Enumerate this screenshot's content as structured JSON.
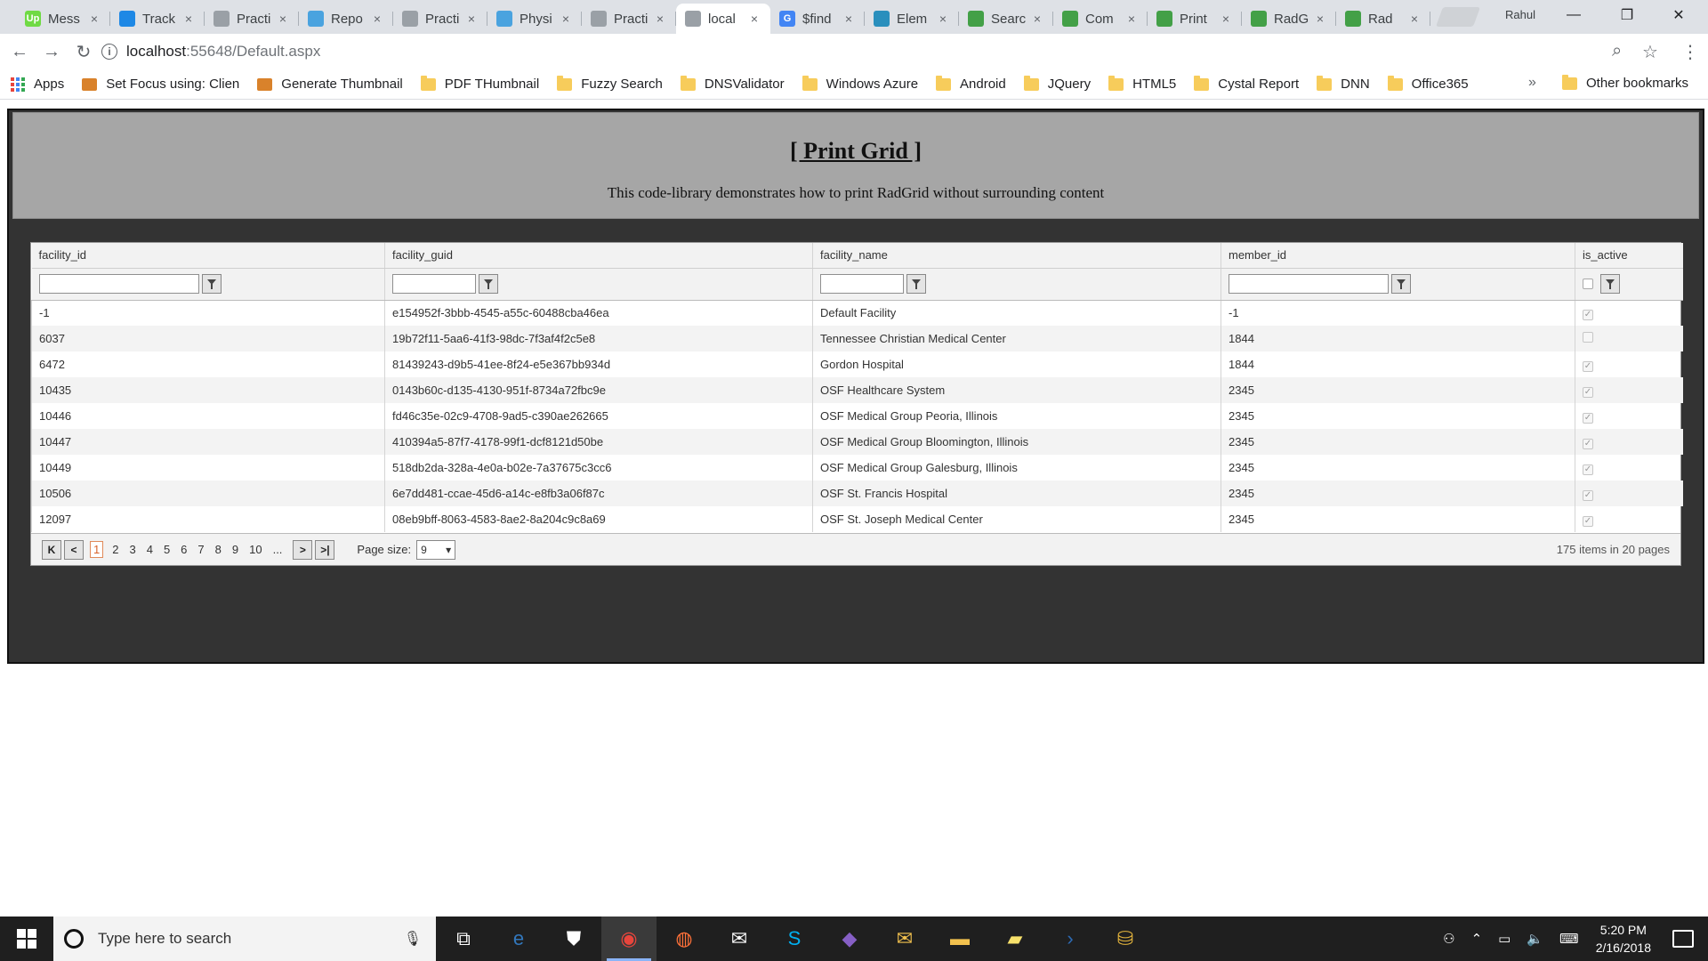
{
  "browser": {
    "tabs": [
      {
        "title": "Mess",
        "fav_text": "Up",
        "fav_color": "#6fda44"
      },
      {
        "title": "Track",
        "fav_text": "",
        "fav_color": "#1e88e5"
      },
      {
        "title": "Practi",
        "fav_text": "",
        "fav_color": "#9aa0a6"
      },
      {
        "title": "Repo",
        "fav_text": "",
        "fav_color": "#4aa3df"
      },
      {
        "title": "Practi",
        "fav_text": "",
        "fav_color": "#9aa0a6"
      },
      {
        "title": "Physi",
        "fav_text": "",
        "fav_color": "#4aa3df"
      },
      {
        "title": "Practi",
        "fav_text": "",
        "fav_color": "#9aa0a6"
      },
      {
        "title": "local",
        "fav_text": "",
        "fav_color": "#9aa0a6",
        "active": true
      },
      {
        "title": "$find",
        "fav_text": "G",
        "fav_color": "#4285f4"
      },
      {
        "title": "Elem",
        "fav_text": "",
        "fav_color": "#2a8fbd"
      },
      {
        "title": "Searc",
        "fav_text": "",
        "fav_color": "#43a047"
      },
      {
        "title": "Com",
        "fav_text": "",
        "fav_color": "#43a047"
      },
      {
        "title": "Print",
        "fav_text": "",
        "fav_color": "#43a047"
      },
      {
        "title": "RadG",
        "fav_text": "",
        "fav_color": "#43a047"
      },
      {
        "title": "Rad",
        "fav_text": "",
        "fav_color": "#43a047"
      }
    ],
    "close_glyph": "×",
    "profile_name": "Rahul",
    "window_controls": {
      "minimize": "—",
      "maximize": "❐",
      "close": "✕"
    },
    "url_host": "localhost",
    "url_path": ":55648/Default.aspx",
    "nav": {
      "back": "←",
      "forward": "→",
      "reload": "↻",
      "zoom": "⌕",
      "star": "☆",
      "menu": "⋮"
    },
    "bookmarks": [
      {
        "label": "Apps",
        "icon": "apps-grid-icon"
      },
      {
        "label": "Set Focus using: Clien",
        "icon": "page-icon"
      },
      {
        "label": "Generate Thumbnail",
        "icon": "page-icon"
      },
      {
        "label": "PDF THumbnail",
        "icon": "folder-icon"
      },
      {
        "label": "Fuzzy Search",
        "icon": "folder-icon"
      },
      {
        "label": "DNSValidator",
        "icon": "folder-icon"
      },
      {
        "label": "Windows Azure",
        "icon": "folder-icon"
      },
      {
        "label": "Android",
        "icon": "folder-icon"
      },
      {
        "label": "JQuery",
        "icon": "folder-icon"
      },
      {
        "label": "HTML5",
        "icon": "folder-icon"
      },
      {
        "label": "Cystal Report",
        "icon": "folder-icon"
      },
      {
        "label": "DNN",
        "icon": "folder-icon"
      },
      {
        "label": "Office365",
        "icon": "folder-icon"
      }
    ],
    "bookmarks_overflow": "»",
    "other_bookmarks": "Other bookmarks"
  },
  "page": {
    "print_link": "[ Print Grid ]",
    "subtitle": "This code-library demonstrates how to print RadGrid without surrounding content"
  },
  "grid": {
    "columns": [
      "facility_id",
      "facility_guid",
      "facility_name",
      "member_id",
      "is_active"
    ],
    "rows": [
      {
        "facility_id": "-1",
        "facility_guid": "e154952f-3bbb-4545-a55c-60488cba46ea",
        "facility_name": "Default Facility",
        "member_id": "-1",
        "is_active": true
      },
      {
        "facility_id": "6037",
        "facility_guid": "19b72f11-5aa6-41f3-98dc-7f3af4f2c5e8",
        "facility_name": "Tennessee Christian Medical Center",
        "member_id": "1844",
        "is_active": false
      },
      {
        "facility_id": "6472",
        "facility_guid": "81439243-d9b5-41ee-8f24-e5e367bb934d",
        "facility_name": "Gordon Hospital",
        "member_id": "1844",
        "is_active": true
      },
      {
        "facility_id": "10435",
        "facility_guid": "0143b60c-d135-4130-951f-8734a72fbc9e",
        "facility_name": "OSF Healthcare System",
        "member_id": "2345",
        "is_active": true
      },
      {
        "facility_id": "10446",
        "facility_guid": "fd46c35e-02c9-4708-9ad5-c390ae262665",
        "facility_name": "OSF Medical Group Peoria, Illinois",
        "member_id": "2345",
        "is_active": true
      },
      {
        "facility_id": "10447",
        "facility_guid": "410394a5-87f7-4178-99f1-dcf8121d50be",
        "facility_name": "OSF Medical Group Bloomington, Illinois",
        "member_id": "2345",
        "is_active": true
      },
      {
        "facility_id": "10449",
        "facility_guid": "518db2da-328a-4e0a-b02e-7a37675c3cc6",
        "facility_name": "OSF Medical Group Galesburg, Illinois",
        "member_id": "2345",
        "is_active": true
      },
      {
        "facility_id": "10506",
        "facility_guid": "6e7dd481-ccae-45d6-a14c-e8fb3a06f87c",
        "facility_name": "OSF St. Francis Hospital",
        "member_id": "2345",
        "is_active": true
      },
      {
        "facility_id": "12097",
        "facility_guid": "08eb9bff-8063-4583-8ae2-8a204c9c8a69",
        "facility_name": "OSF St. Joseph Medical Center",
        "member_id": "2345",
        "is_active": true
      }
    ],
    "pager": {
      "first": "K",
      "prev": "<",
      "next": ">",
      "last": ">|",
      "pages": [
        "1",
        "2",
        "3",
        "4",
        "5",
        "6",
        "7",
        "8",
        "9",
        "10",
        "..."
      ],
      "current_page": "1",
      "page_size_label": "Page size:",
      "page_size": "9",
      "info": "175 items in 20 pages"
    }
  },
  "taskbar": {
    "search_placeholder": "Type here to search",
    "apps": [
      {
        "name": "task-view-icon",
        "glyph": "⧉"
      },
      {
        "name": "edge-icon",
        "glyph": "e",
        "color": "#3277bc"
      },
      {
        "name": "store-icon",
        "glyph": "⛊"
      },
      {
        "name": "chrome-icon",
        "glyph": "◉",
        "color": "#e8453c",
        "active": true
      },
      {
        "name": "firefox-icon",
        "glyph": "◍",
        "color": "#ff7139"
      },
      {
        "name": "mail-icon",
        "glyph": "✉"
      },
      {
        "name": "skype-icon",
        "glyph": "S",
        "color": "#00aff0"
      },
      {
        "name": "visual-studio-icon",
        "glyph": "◆",
        "color": "#865fc5"
      },
      {
        "name": "outlook-icon",
        "glyph": "✉",
        "color": "#f2c14e"
      },
      {
        "name": "file-explorer-icon",
        "glyph": "▬",
        "color": "#f2c14e"
      },
      {
        "name": "sticky-notes-icon",
        "glyph": "▰",
        "color": "#f7e16b"
      },
      {
        "name": "powershell-icon",
        "glyph": "›",
        "color": "#2d6bb5"
      },
      {
        "name": "sql-tool-icon",
        "glyph": "⛁",
        "color": "#e3b33c"
      }
    ],
    "time": "5:20 PM",
    "date": "2/16/2018"
  }
}
